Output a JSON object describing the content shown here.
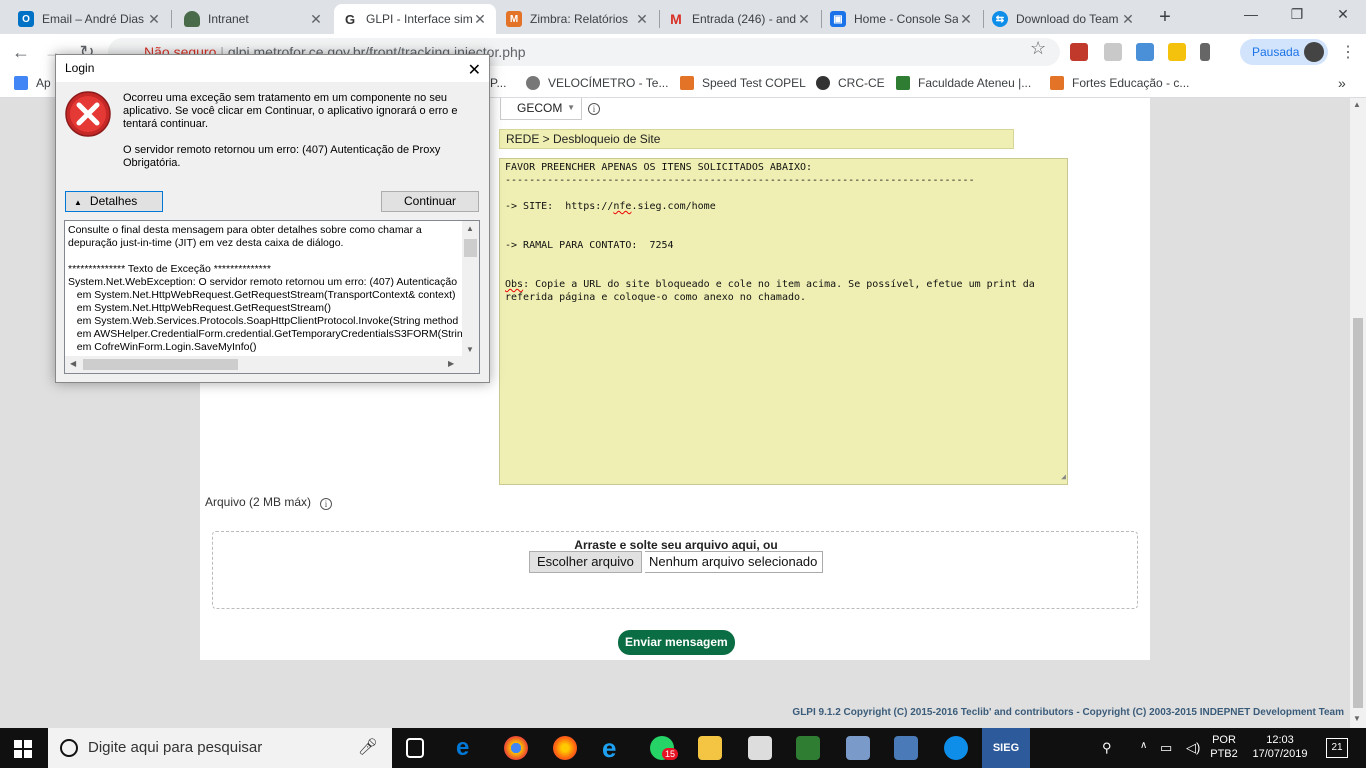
{
  "browser": {
    "tabs": [
      {
        "title": "Email – André Dias",
        "color": "#0072c6",
        "glyph": "O",
        "active": false
      },
      {
        "title": "Intranet",
        "color": "#4a6b4a",
        "glyph": "",
        "active": false
      },
      {
        "title": "GLPI - Interface sim",
        "color": "#ffffff",
        "glyph": "G",
        "active": true
      },
      {
        "title": "Zimbra: Relatórios",
        "color": "#e37326",
        "glyph": "M",
        "active": false
      },
      {
        "title": "Entrada (246) - and",
        "color": "#ffffff",
        "glyph": "M",
        "active": false
      },
      {
        "title": "Home - Console Sa",
        "color": "#1a73e8",
        "glyph": "▣",
        "active": false
      },
      {
        "title": "Download do Team",
        "color": "#0e8ee9",
        "glyph": "⇆",
        "active": false
      }
    ],
    "address": {
      "security_label": "Não seguro",
      "url": "glpi.metrofor.ce.gov.br/front/tracking.injector.php"
    },
    "profile_label": "Pausada",
    "bookmarks": [
      {
        "label": "Ap",
        "color": "#4285f4"
      },
      {
        "label": "P...",
        "color": "#888888"
      },
      {
        "label": "VELOCÍMETRO - Te...",
        "color": "#777777"
      },
      {
        "label": "Speed Test COPEL",
        "color": "#e37326"
      },
      {
        "label": "CRC-CE",
        "color": "#333333"
      },
      {
        "label": "Faculdade Ateneu |...",
        "color": "#2e7d32"
      },
      {
        "label": "Fortes Educação - c...",
        "color": "#e37326"
      }
    ]
  },
  "glpi": {
    "group_select": "GECOM",
    "title_value": "REDE > Desbloqueio de Site",
    "description": {
      "line1": "FAVOR PREENCHER APENAS OS ITENS SOLICITADOS ABAIXO:",
      "line2": "------------------------------------------------------------------------------",
      "site_prefix": "-> SITE:  https://",
      "site_underlined": "nfe",
      "site_suffix": ".sieg.com/home",
      "ramal": "-> RAMAL PARA CONTATO:  7254",
      "obs_word": "Obs",
      "obs_line1": ": Copie a URL do site bloqueado e cole no item acima. Se possível, efetue um print da",
      "obs_line2": "referida página e coloque-o como anexo no chamado."
    },
    "attachment_label": "Arquivo (2 MB máx)",
    "drop_text": "Arraste e solte seu arquivo aqui, ou",
    "choose_file_button": "Escolher arquivo",
    "no_file_text": "Nenhum arquivo selecionado",
    "send_button": "Enviar mensagem",
    "footer": "GLPI 9.1.2 Copyright (C) 2015-2016 Teclib' and contributors - Copyright (C) 2003-2015 INDEPNET Development Team"
  },
  "dialog": {
    "title": "Login",
    "message1": "Ocorreu uma exceção sem tratamento em um componente no seu aplicativo. Se você clicar em Continuar, o aplicativo ignorará o erro e tentará continuar.",
    "message2": "O servidor remoto retornou um erro: (407) Autenticação de Proxy Obrigatória.",
    "details_button": "Detalhes",
    "continue_button": "Continuar",
    "details_text": "Consulte o final desta mensagem para obter detalhes sobre como chamar a\ndepuração just-in-time (JIT) em vez desta caixa de diálogo.\n\n************** Texto de Exceção **************\nSystem.Net.WebException: O servidor remoto retornou um erro: (407) Autenticação\n   em System.Net.HttpWebRequest.GetRequestStream(TransportContext& context)\n   em System.Net.HttpWebRequest.GetRequestStream()\n   em System.Web.Services.Protocols.SoapHttpClientProtocol.Invoke(String method\n   em AWSHelper.CredentialForm.credential.GetTemporaryCredentialsS3FORM(Strin\n   em CofreWinForm.Login.SaveMyInfo()"
  },
  "taskbar": {
    "search_placeholder": "Digite aqui para pesquisar",
    "whatsapp_badge": "15",
    "language": "POR",
    "layout": "PTB2",
    "time": "12:03",
    "date": "17/07/2019",
    "notifications": "21",
    "sieg_label": "SIEG"
  }
}
